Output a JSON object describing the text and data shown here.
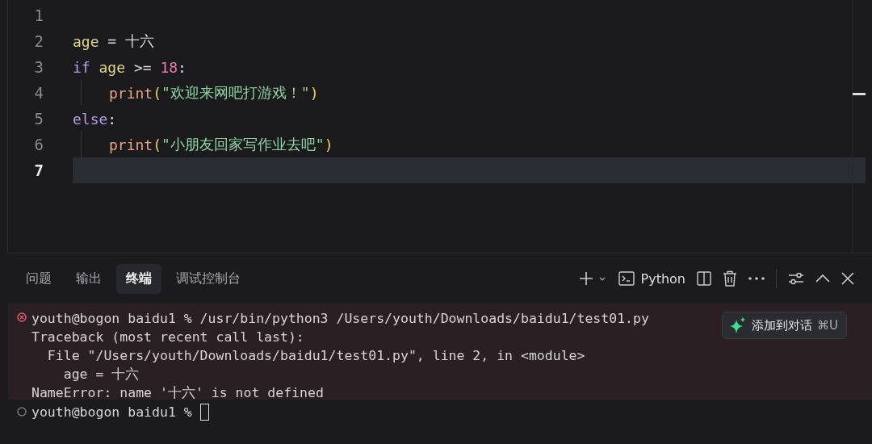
{
  "editor": {
    "lines": [
      {
        "number": "1",
        "active": false
      },
      {
        "number": "2",
        "active": false,
        "tokens": [
          {
            "kind": "variable",
            "text": "age"
          },
          {
            "kind": "plain",
            "text": " = 十六"
          }
        ]
      },
      {
        "number": "3",
        "active": false,
        "tokens": [
          {
            "kind": "keyword",
            "text": "if"
          },
          {
            "kind": "variable",
            "text": " age"
          },
          {
            "kind": "plain",
            "text": " >= "
          },
          {
            "kind": "number",
            "text": "18"
          },
          {
            "kind": "plain",
            "text": ":"
          }
        ],
        "children": [
          {
            "number": "4",
            "active": false,
            "tokens": [
              {
                "kind": "function",
                "text": "print"
              },
              {
                "kind": "paren",
                "text": "("
              },
              {
                "kind": "string",
                "text": "\"欢迎来网吧打游戏！\""
              },
              {
                "kind": "paren",
                "text": ")"
              }
            ]
          }
        ]
      },
      {
        "number": "5",
        "active": false,
        "tokens": [
          {
            "kind": "keyword",
            "text": "else"
          },
          {
            "kind": "plain",
            "text": ":"
          }
        ],
        "children": [
          {
            "number": "6",
            "active": false,
            "tokens": [
              {
                "kind": "function",
                "text": "print"
              },
              {
                "kind": "paren",
                "text": "("
              },
              {
                "kind": "string",
                "text": "\"小朋友回家写作业去吧\""
              },
              {
                "kind": "paren",
                "text": ")"
              }
            ]
          }
        ]
      },
      {
        "number": "7",
        "active": true
      }
    ]
  },
  "panel": {
    "tabs": [
      {
        "label": "问题",
        "selected": false
      },
      {
        "label": "输出",
        "selected": false
      },
      {
        "label": "终端",
        "selected": true
      },
      {
        "label": "调试控制台",
        "selected": false
      }
    ],
    "terminal_name": "Python",
    "terminal": {
      "blocks": [
        {
          "kind": "error",
          "lines": [
            "youth@bogon baidu1 % /usr/bin/python3 /Users/youth/Downloads/baidu1/test01.py",
            "Traceback (most recent call last):",
            "  File \"/Users/youth/Downloads/baidu1/test01.py\", line 2, in <module>",
            "    age = 十六",
            "NameError: name '十六' is not defined"
          ]
        },
        {
          "kind": "idle",
          "lines": [
            "youth@bogon baidu1 % "
          ],
          "cursor": true
        }
      ],
      "add_to_chat": {
        "label": "添加到对话",
        "shortcut": "⌘U"
      }
    }
  }
}
